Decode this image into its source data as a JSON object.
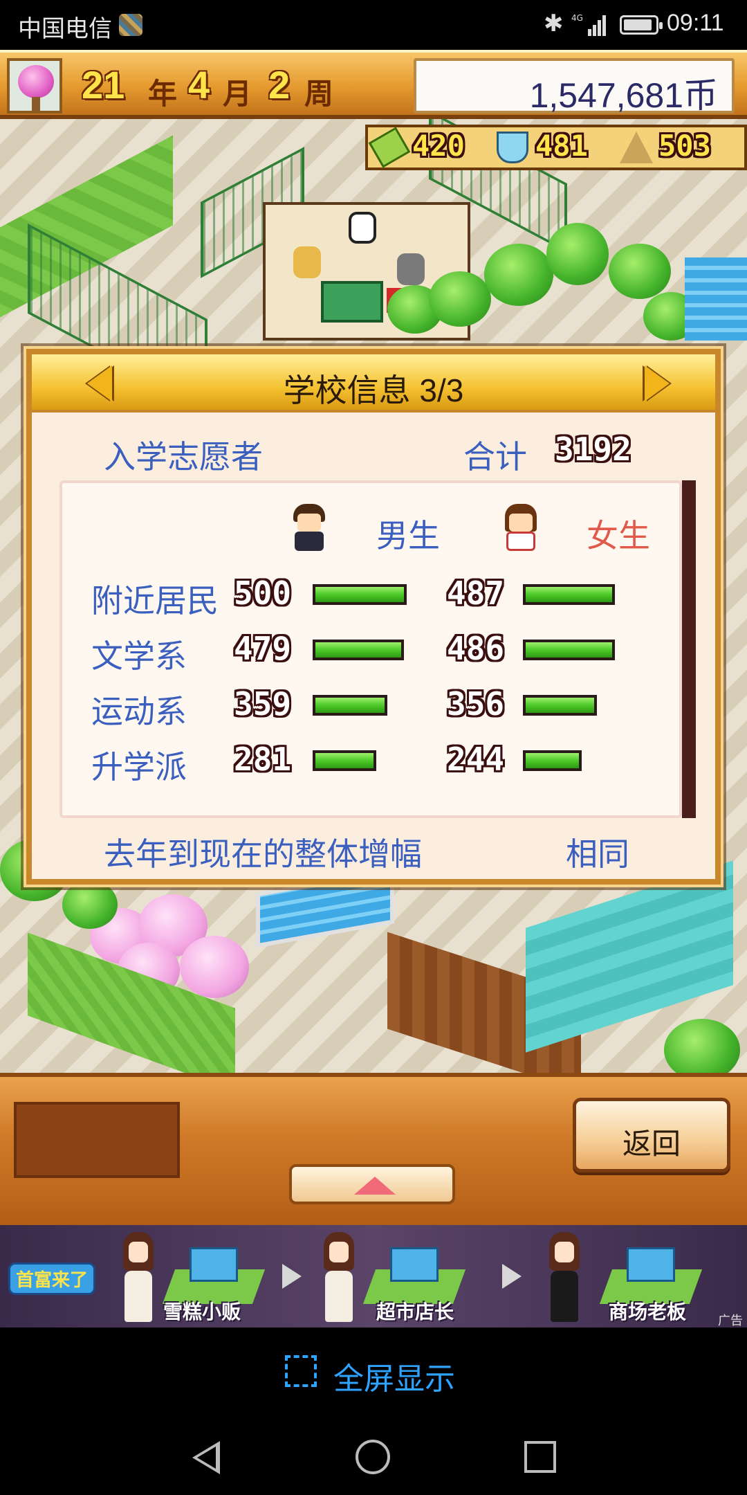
{
  "status_bar": {
    "carrier": "中国电信",
    "network": "4G",
    "time": "09:11"
  },
  "top_bar": {
    "year_num": "21",
    "year_unit": "年",
    "month_num": "4",
    "month_unit": "月",
    "week_num": "2",
    "week_unit": "周",
    "money": "1,547,681币"
  },
  "world_stats": {
    "pencil": "420",
    "science": "481",
    "sports": "503"
  },
  "dialog": {
    "title": "学校信息 3/3",
    "applicants_label": "入学志愿者",
    "total_label": "合计",
    "total_value": "3192",
    "male_label": "男生",
    "female_label": "女生",
    "rows": [
      {
        "label": "附近居民",
        "male": "500",
        "female": "487",
        "male_ratio": 1.0,
        "female_ratio": 0.974
      },
      {
        "label": "文学系",
        "male": "479",
        "female": "486",
        "male_ratio": 0.958,
        "female_ratio": 0.972
      },
      {
        "label": "运动系",
        "male": "359",
        "female": "356",
        "male_ratio": 0.718,
        "female_ratio": 0.712
      },
      {
        "label": "升学派",
        "male": "281",
        "female": "244",
        "male_ratio": 0.562,
        "female_ratio": 0.488
      }
    ],
    "growth_label": "去年到现在的整体增幅",
    "growth_value": "相同"
  },
  "controls": {
    "back_label": "返回"
  },
  "ad": {
    "badge": "首富来了",
    "step1": "雪糕小贩",
    "step2": "超市店长",
    "step3": "商场老板",
    "tag": "广告"
  },
  "fullscreen": {
    "label": "全屏显示"
  }
}
